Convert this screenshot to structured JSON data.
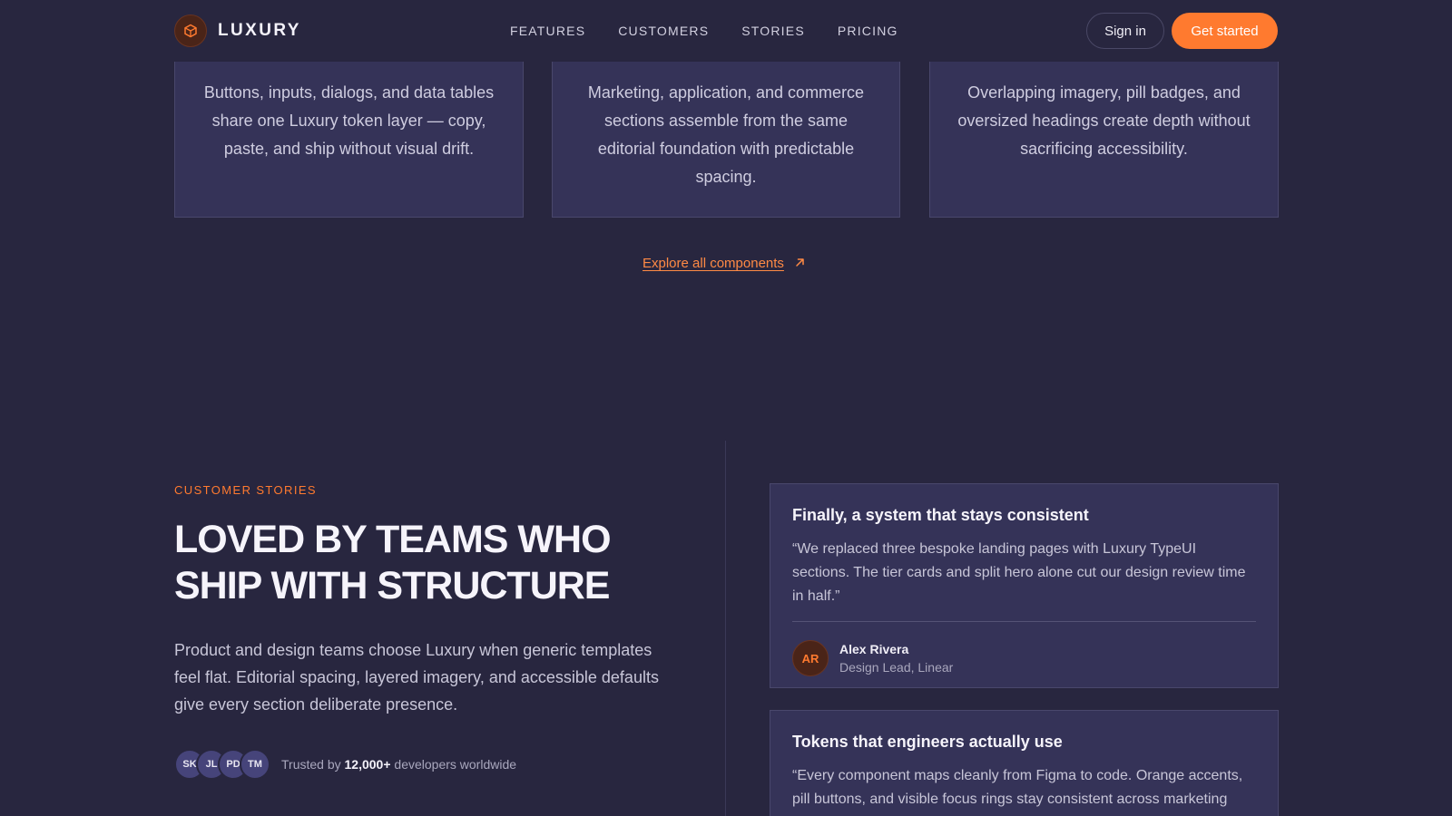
{
  "brand": {
    "name": "LUXURY",
    "accent_color": "#ff7a2f",
    "logo_icon": "cube-icon"
  },
  "nav": {
    "items": [
      {
        "label": "FEATURES"
      },
      {
        "label": "CUSTOMERS"
      },
      {
        "label": "STORIES"
      },
      {
        "label": "PRICING"
      }
    ],
    "signin_label": "Sign in",
    "cta_label": "Get started"
  },
  "features": {
    "cards": [
      {
        "text": "Buttons, inputs, dialogs, and data tables share one Luxury token layer — copy, paste, and ship without visual drift."
      },
      {
        "text": "Marketing, application, and commerce sections assemble from the same editorial foundation with predictable spacing."
      },
      {
        "text": "Overlapping imagery, pill badges, and oversized headings create depth without sacrificing accessibility."
      }
    ],
    "explore_label": "Explore all components",
    "explore_icon": "arrow-up-right-icon"
  },
  "stories": {
    "eyebrow": "CUSTOMER STORIES",
    "headline": "LOVED BY TEAMS WHO SHIP WITH STRUCTURE",
    "lead": "Product and design teams choose Luxury when generic templates feel flat. Editorial spacing, layered imagery, and accessible defaults give every section deliberate presence.",
    "avatars": [
      "SK",
      "JL",
      "PD",
      "TM"
    ],
    "trust_prefix": "Trusted by ",
    "trust_count": "12,000+",
    "trust_suffix": " developers worldwide",
    "testimonials": [
      {
        "title": "Finally, a system that stays consistent",
        "quote": "“We replaced three bespoke landing pages with Luxury TypeUI sections. The tier cards and split hero alone cut our design review time in half.”",
        "initials": "AR",
        "name": "Alex Rivera",
        "role": "Design Lead, Linear"
      },
      {
        "title": "Tokens that engineers actually use",
        "quote": "“Every component maps cleanly from Figma to code. Orange accents, pill buttons, and visible focus rings stay consistent across marketing"
      }
    ]
  }
}
